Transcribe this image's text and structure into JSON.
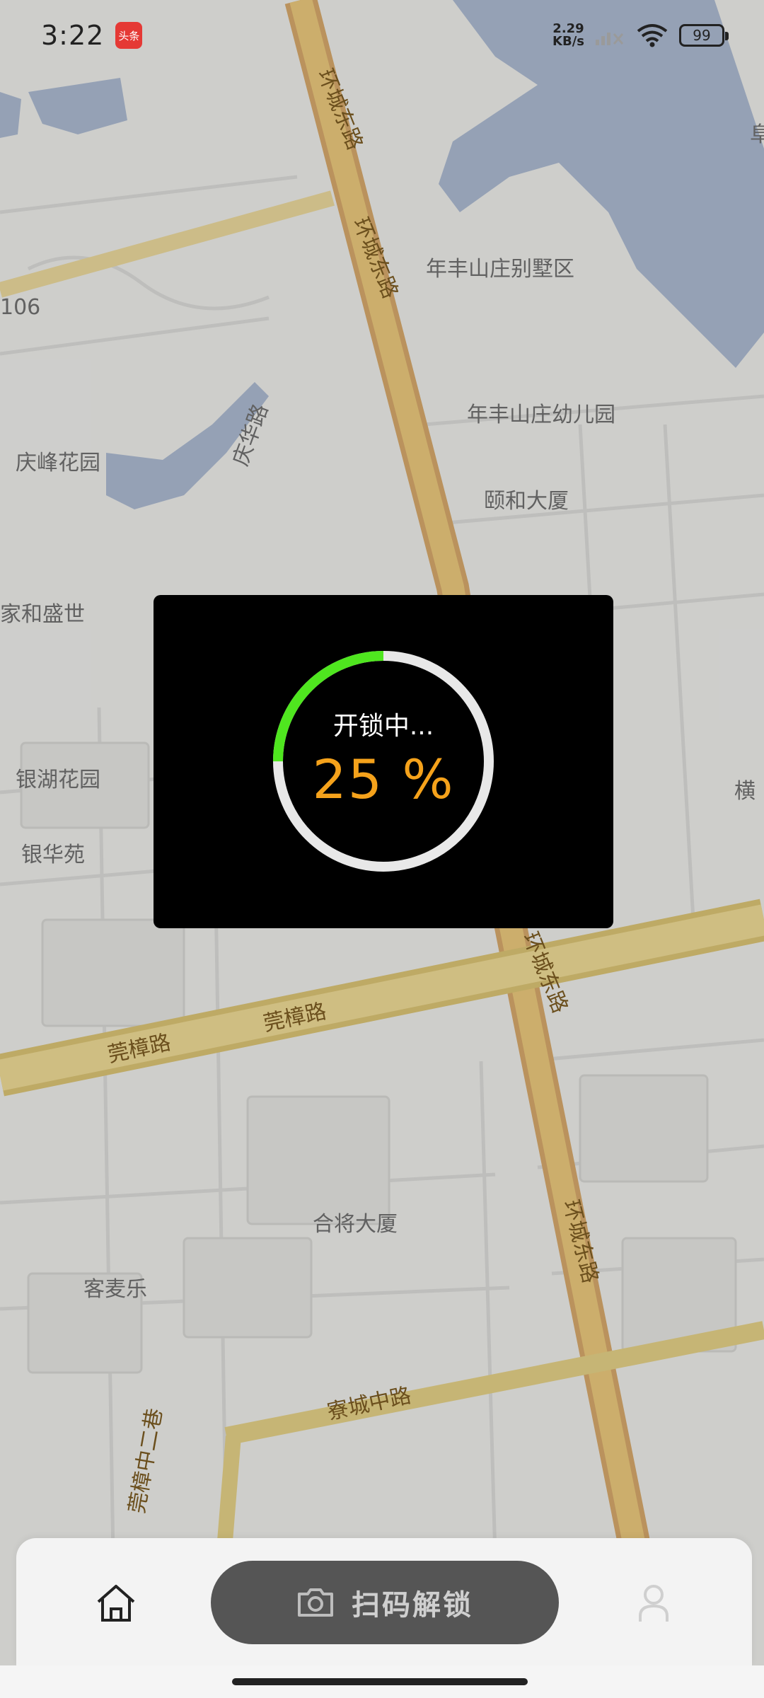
{
  "status_bar": {
    "time": "3:22",
    "app_badge": "头条",
    "net_speed_value": "2.29",
    "net_speed_unit": "KB/s",
    "battery": "99"
  },
  "map": {
    "labels": {
      "huancheng_east_1": "环城东路",
      "huancheng_east_2": "环城东路",
      "huancheng_east_3": "环城东路",
      "huancheng_east_4": "环城东路",
      "nianfeng_villa": "年丰山庄别墅区",
      "nianfeng_kindergarten": "年丰山庄幼儿园",
      "yihe_building": "颐和大厦",
      "qingfeng_garden": "庆峰花园",
      "qinghua_road": "庆华路",
      "number_106": "106",
      "jiahe_shengshi": "家和盛世",
      "yinhu_garden": "银湖花园",
      "yinhua_yuan": "银华苑",
      "guanzhang_road_1": "莞樟路",
      "guanzhang_road_2": "莞樟路",
      "hejiang_building": "合将大厦",
      "kemaile": "客麦乐",
      "liaocheng_middle": "寮城中路",
      "guanzhang_lane": "莞樟中二巷",
      "heng_partial": "横",
      "fu_partial": "阜"
    }
  },
  "unlock_dialog": {
    "status": "开锁中...",
    "percent_text": "25 %",
    "progress": 0.25,
    "ring_color": "#4fe61f",
    "track_color": "#e8e8e8",
    "percent_color": "#f5a21b"
  },
  "bottom_nav": {
    "scan_label": "扫码解锁",
    "home_icon": "home-icon",
    "scan_icon": "camera-icon",
    "profile_icon": "user-icon"
  }
}
